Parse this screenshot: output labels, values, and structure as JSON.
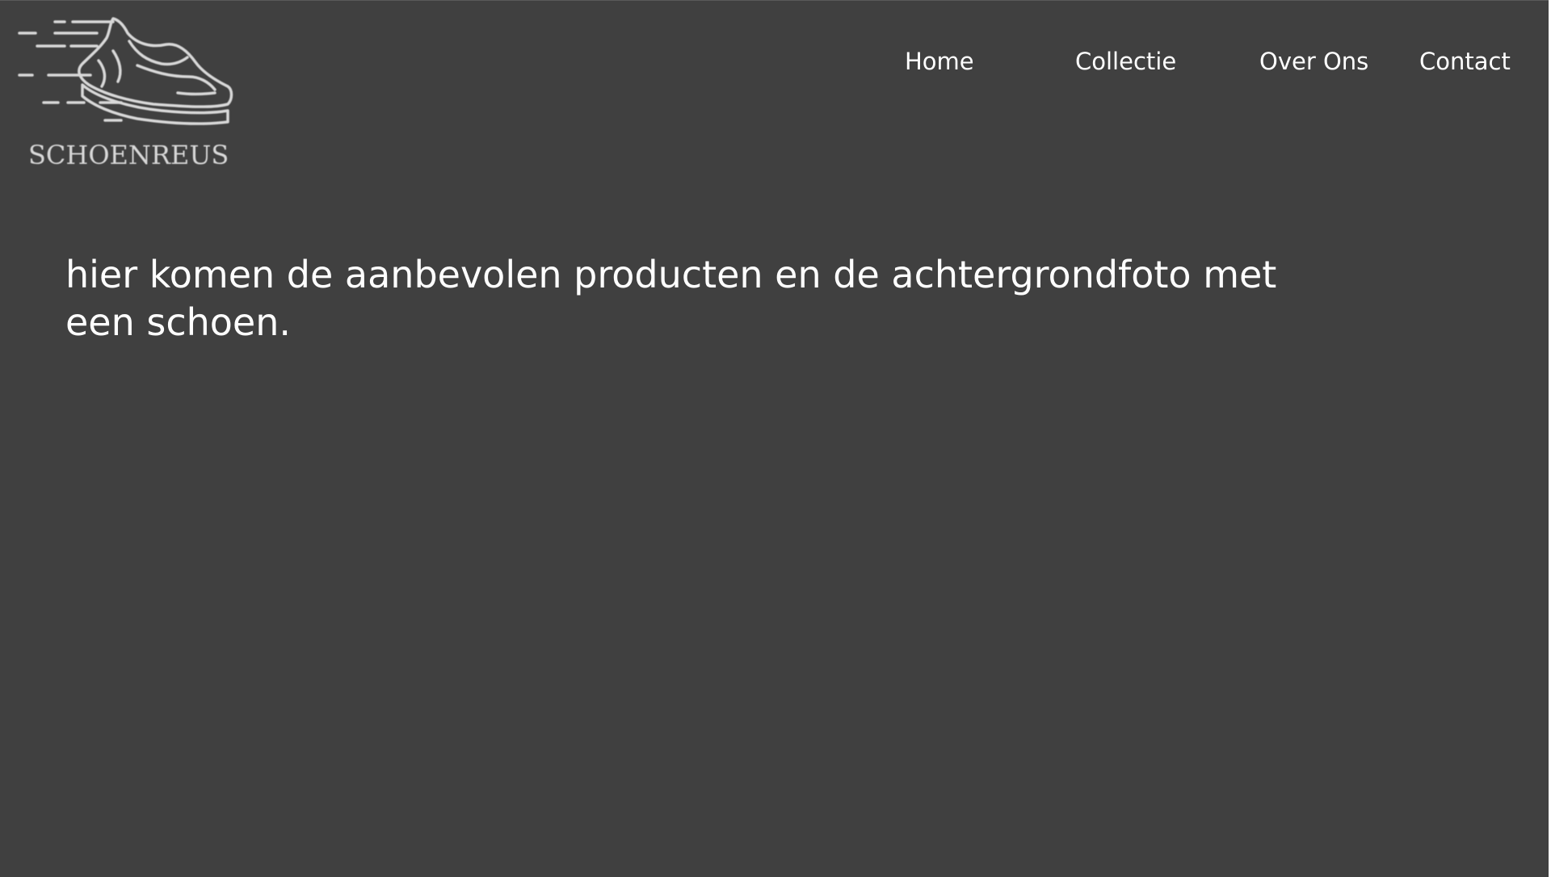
{
  "brand": {
    "name": "SCHOENREUS",
    "logo_icon": "running-shoe-icon"
  },
  "nav": {
    "items": [
      {
        "label": "Home"
      },
      {
        "label": "Collectie"
      },
      {
        "label": "Over Ons"
      },
      {
        "label": "Contact"
      }
    ]
  },
  "hero": {
    "text": "hier komen de aanbevolen producten en de achtergrondfoto met een schoen."
  },
  "colors": {
    "background": "#404040",
    "text": "#ffffff",
    "logo": "#d8d8d8"
  }
}
